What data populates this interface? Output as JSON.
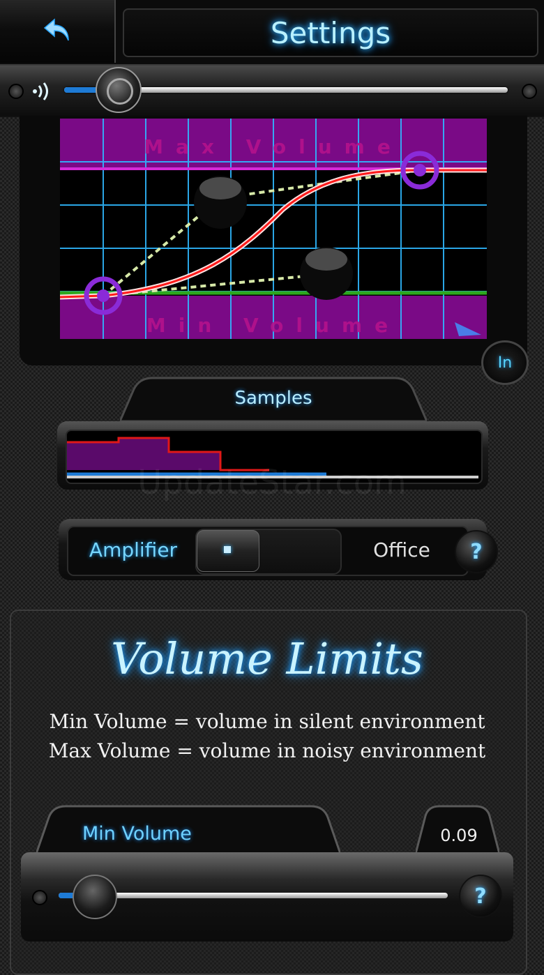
{
  "header": {
    "title": "Settings",
    "back_icon": "back-arrow-icon"
  },
  "volume": {
    "icon": "speaker-icon",
    "level": 0.12,
    "fill_color": "#1e7bd6"
  },
  "curve_graph": {
    "max_label": "Max Volume",
    "min_label": "Min Volume",
    "in_button": "In",
    "grid_color": "#2fb8ff",
    "zone_color": "#7a0a86",
    "curve_color": "#ff1a1a",
    "min_line_color": "#2ea81e"
  },
  "samples": {
    "label": "Samples",
    "bar_color": "#5a0a6a",
    "step_line_color": "#e01818"
  },
  "watermark": "UpdateStar.com",
  "mode_switch": {
    "left_label": "Amplifier",
    "right_label": "Office",
    "selected": "Amplifier",
    "help_label": "?"
  },
  "limits": {
    "title": "Volume Limits",
    "line1": "Min Volume = volume in silent environment",
    "line2": "Max Volume = volume in noisy environment"
  },
  "min_volume": {
    "label": "Min Volume",
    "value": "0.09",
    "level": 0.09,
    "help_label": "?"
  }
}
